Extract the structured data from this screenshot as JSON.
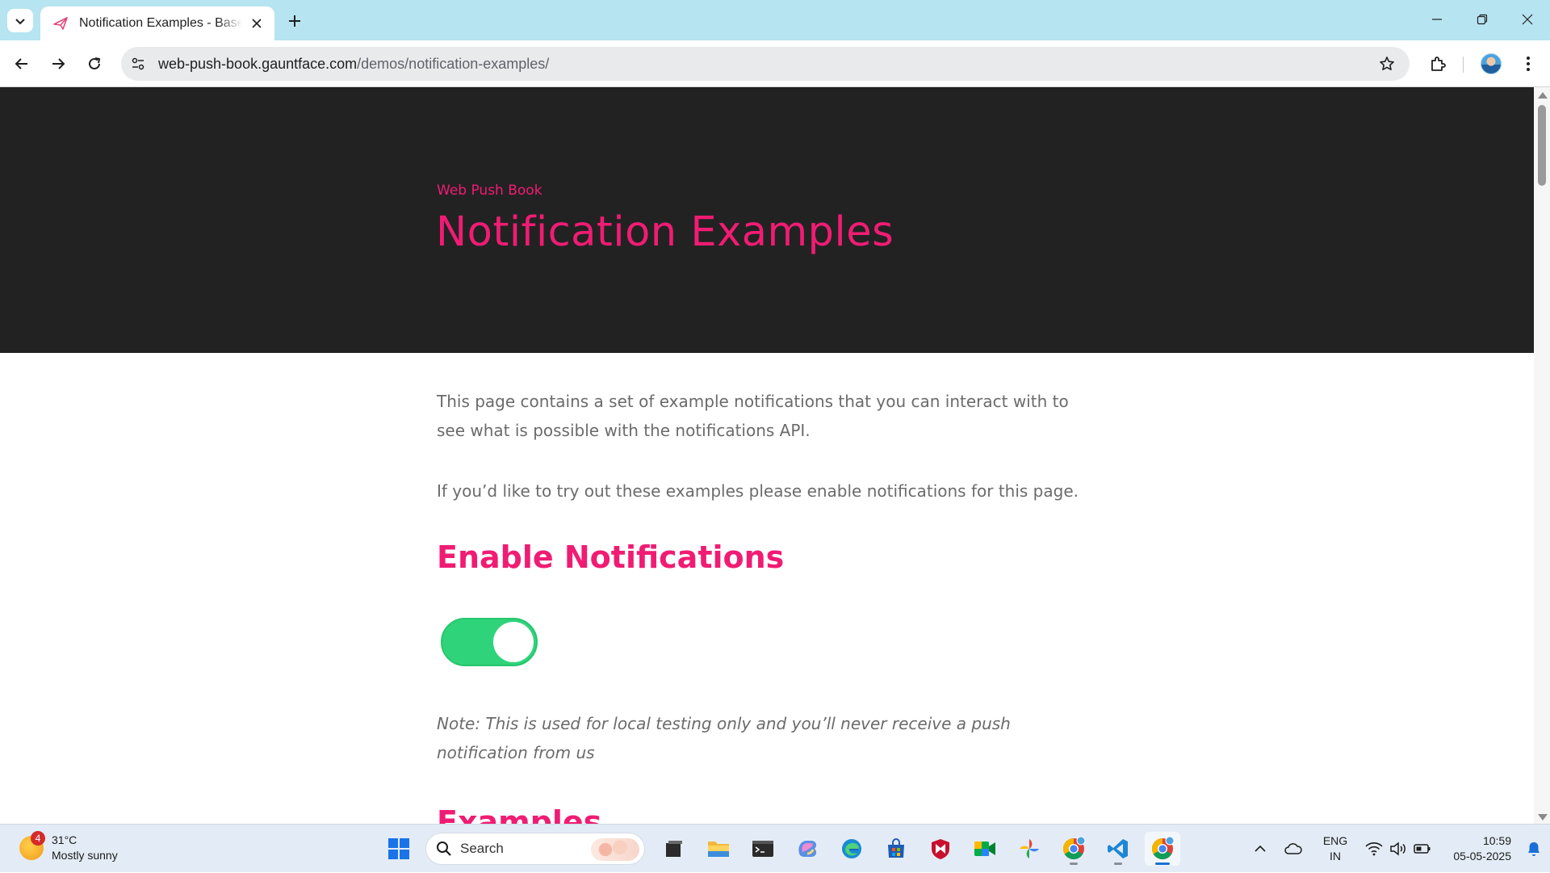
{
  "browser": {
    "tab": {
      "title": "Notification Examples - Base Site"
    },
    "url": {
      "domain": "web-push-book.gauntface.com",
      "path": "/demos/notification-examples/"
    }
  },
  "page": {
    "hero": {
      "subtitle": "Web Push Book",
      "title": "Notification Examples"
    },
    "intro": "This page contains a set of example notifications that you can interact with to see what is possible with the notifications API.",
    "enable_prompt": "If you’d like to try out these examples please enable notifications for this page.",
    "enable_heading": "Enable Notifications",
    "toggle_state": "on",
    "note": "Note: This is used for local testing only and you’ll never receive a push notification from us",
    "examples_heading": "Examples"
  },
  "taskbar": {
    "weather": {
      "temp": "31°C",
      "condition": "Mostly sunny",
      "badge": "4"
    },
    "search_placeholder": "Search",
    "lang": {
      "line1": "ENG",
      "line2": "IN"
    },
    "clock": {
      "time": "10:59",
      "date": "05-05-2025"
    }
  },
  "colors": {
    "accent": "#f01c73",
    "hero_bg": "#232223",
    "toggle_on": "#2fd47a",
    "tabstrip": "#b6e4f0"
  }
}
